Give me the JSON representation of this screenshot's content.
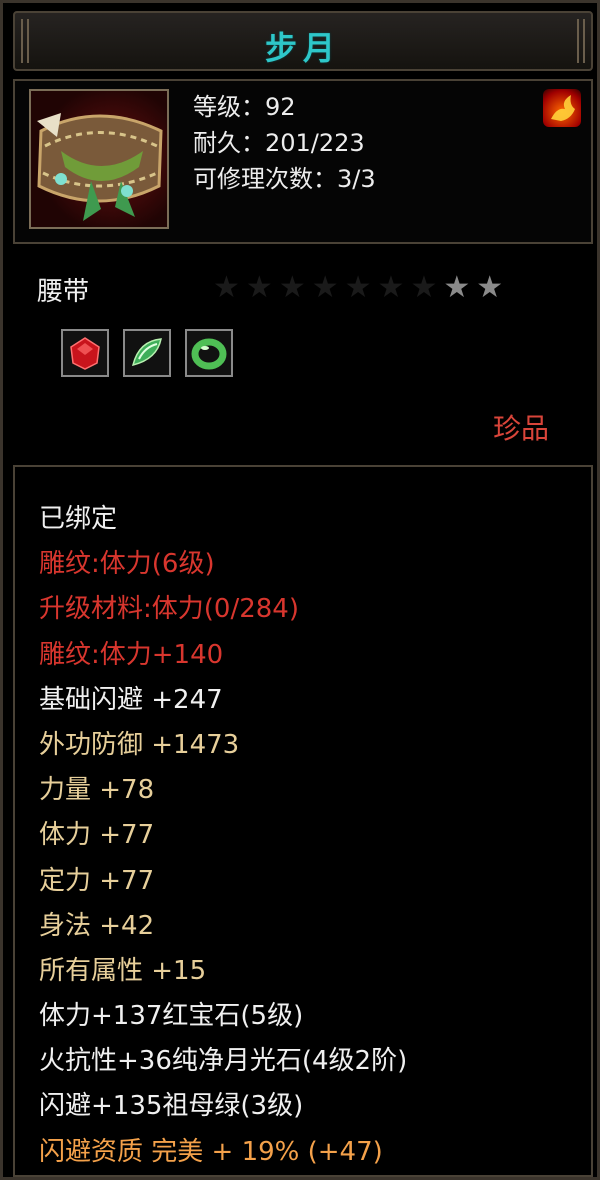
{
  "item": {
    "name": "步月",
    "stats": [
      "等级：92",
      "耐久：201/223",
      "可修理次数：3/3"
    ],
    "type": "腰带",
    "stars_total": 9,
    "stars_lit": 2,
    "gems": [
      "red-gem-icon",
      "green-gem-icon",
      "green-ring-gem-icon"
    ],
    "rarity": "珍品"
  },
  "attributes": [
    {
      "text": "已绑定",
      "color": "white"
    },
    {
      "text": "雕纹:体力(6级)",
      "color": "red"
    },
    {
      "text": "升级材料:体力(0/284)",
      "color": "red"
    },
    {
      "text": "雕纹:体力+140",
      "color": "red"
    },
    {
      "text": "基础闪避  +247",
      "color": "white"
    },
    {
      "text": "外功防御  +1473",
      "color": "tan"
    },
    {
      "text": "力量  +78",
      "color": "tan"
    },
    {
      "text": "体力  +77",
      "color": "tan"
    },
    {
      "text": "定力  +77",
      "color": "tan"
    },
    {
      "text": "身法  +42",
      "color": "tan"
    },
    {
      "text": "所有属性  +15",
      "color": "tan"
    },
    {
      "text": "体力+137红宝石(5级)",
      "color": "white"
    },
    {
      "text": "火抗性+36纯净月光石(4级2阶)",
      "color": "white"
    },
    {
      "text": "闪避+135祖母绿(3级)",
      "color": "white"
    },
    {
      "text": "闪避资质  完美  + 19% (+47)",
      "color": "orange"
    }
  ]
}
